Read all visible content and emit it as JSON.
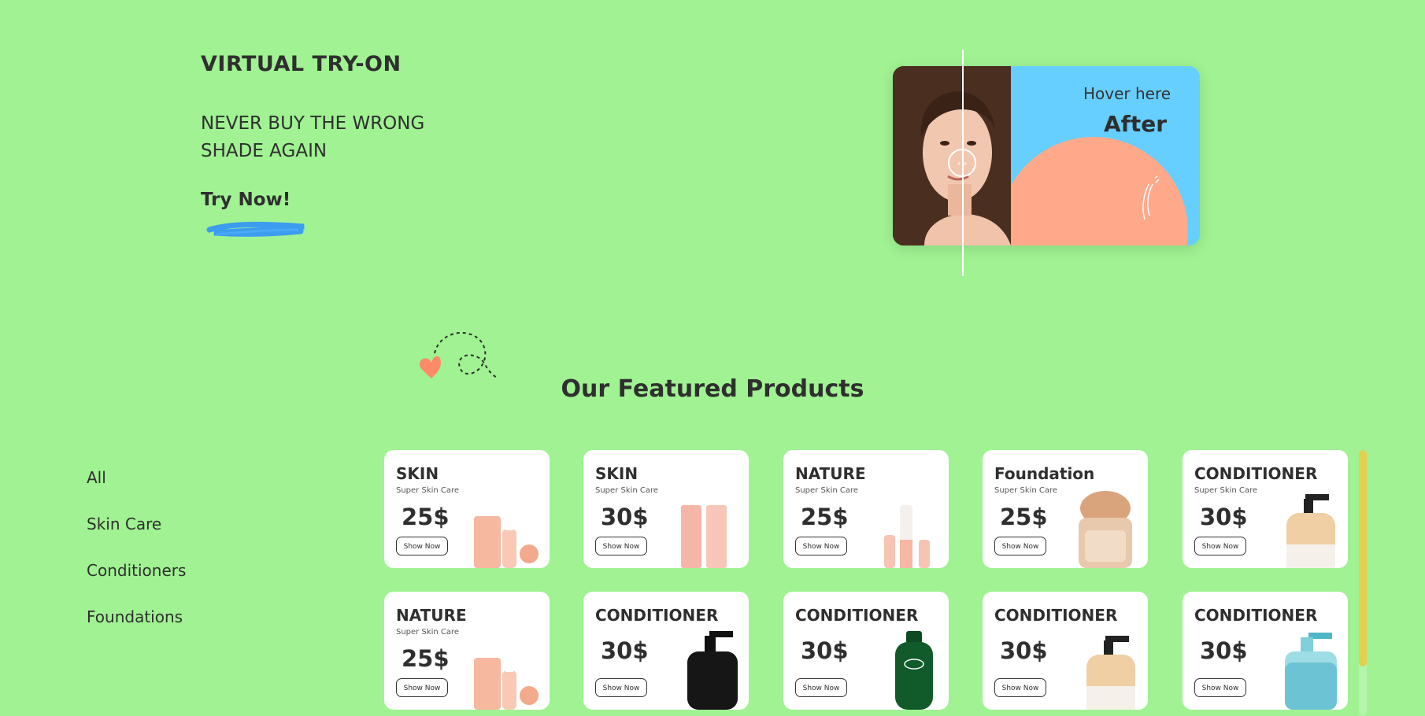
{
  "hero": {
    "title": "VIRTUAL TRY-ON",
    "subtitle": "NEVER BUY THE WRONG SHADE AGAIN",
    "cta": "Try Now!"
  },
  "compare_card": {
    "hint": "Hover here",
    "after_label": "After",
    "handle": "‹ ›"
  },
  "section_title": "Our Featured Products",
  "categories": [
    "All",
    "Skin Care",
    "Conditioners",
    "Foundations"
  ],
  "products": [
    {
      "name": "SKIN",
      "tagline": "Super Skin Care",
      "price": "25$",
      "button": "Show Now",
      "icon": "peach-skincare-set"
    },
    {
      "name": "SKIN",
      "tagline": "Super Skin Care",
      "price": "30$",
      "button": "Show Now",
      "icon": "pink-tubes"
    },
    {
      "name": "NATURE",
      "tagline": "Super Skin Care",
      "price": "25$",
      "button": "Show Now",
      "icon": "pump-bottles"
    },
    {
      "name": "Foundation",
      "tagline": "Super Skin Care",
      "price": "25$",
      "button": "Show Now",
      "icon": "foundation-jar"
    },
    {
      "name": "CONDITIONER",
      "tagline": "Super Skin Care",
      "price": "30$",
      "button": "Show Now",
      "icon": "beige-pump-bottle"
    },
    {
      "name": "NATURE",
      "tagline": "Super Skin Care",
      "price": "25$",
      "button": "Show Now",
      "icon": "peach-skincare-set"
    },
    {
      "name": "CONDITIONER",
      "tagline": "",
      "price": "30$",
      "button": "Show Now",
      "icon": "black-pump-bottle"
    },
    {
      "name": "CONDITIONER",
      "tagline": "",
      "price": "30$",
      "button": "Show Now",
      "icon": "green-tea-tree-bottle"
    },
    {
      "name": "CONDITIONER",
      "tagline": "",
      "price": "30$",
      "button": "Show Now",
      "icon": "beige-pump-bottle"
    },
    {
      "name": "CONDITIONER",
      "tagline": "",
      "price": "30$",
      "button": "Show Now",
      "icon": "blue-gel-bottle"
    }
  ],
  "colors": {
    "background": "#a0f292",
    "card_blue": "#66cfff",
    "accent_orange": "#ffa98a",
    "brush_blue": "#3b9cf0",
    "scroll_thumb": "#e4cf4e"
  }
}
